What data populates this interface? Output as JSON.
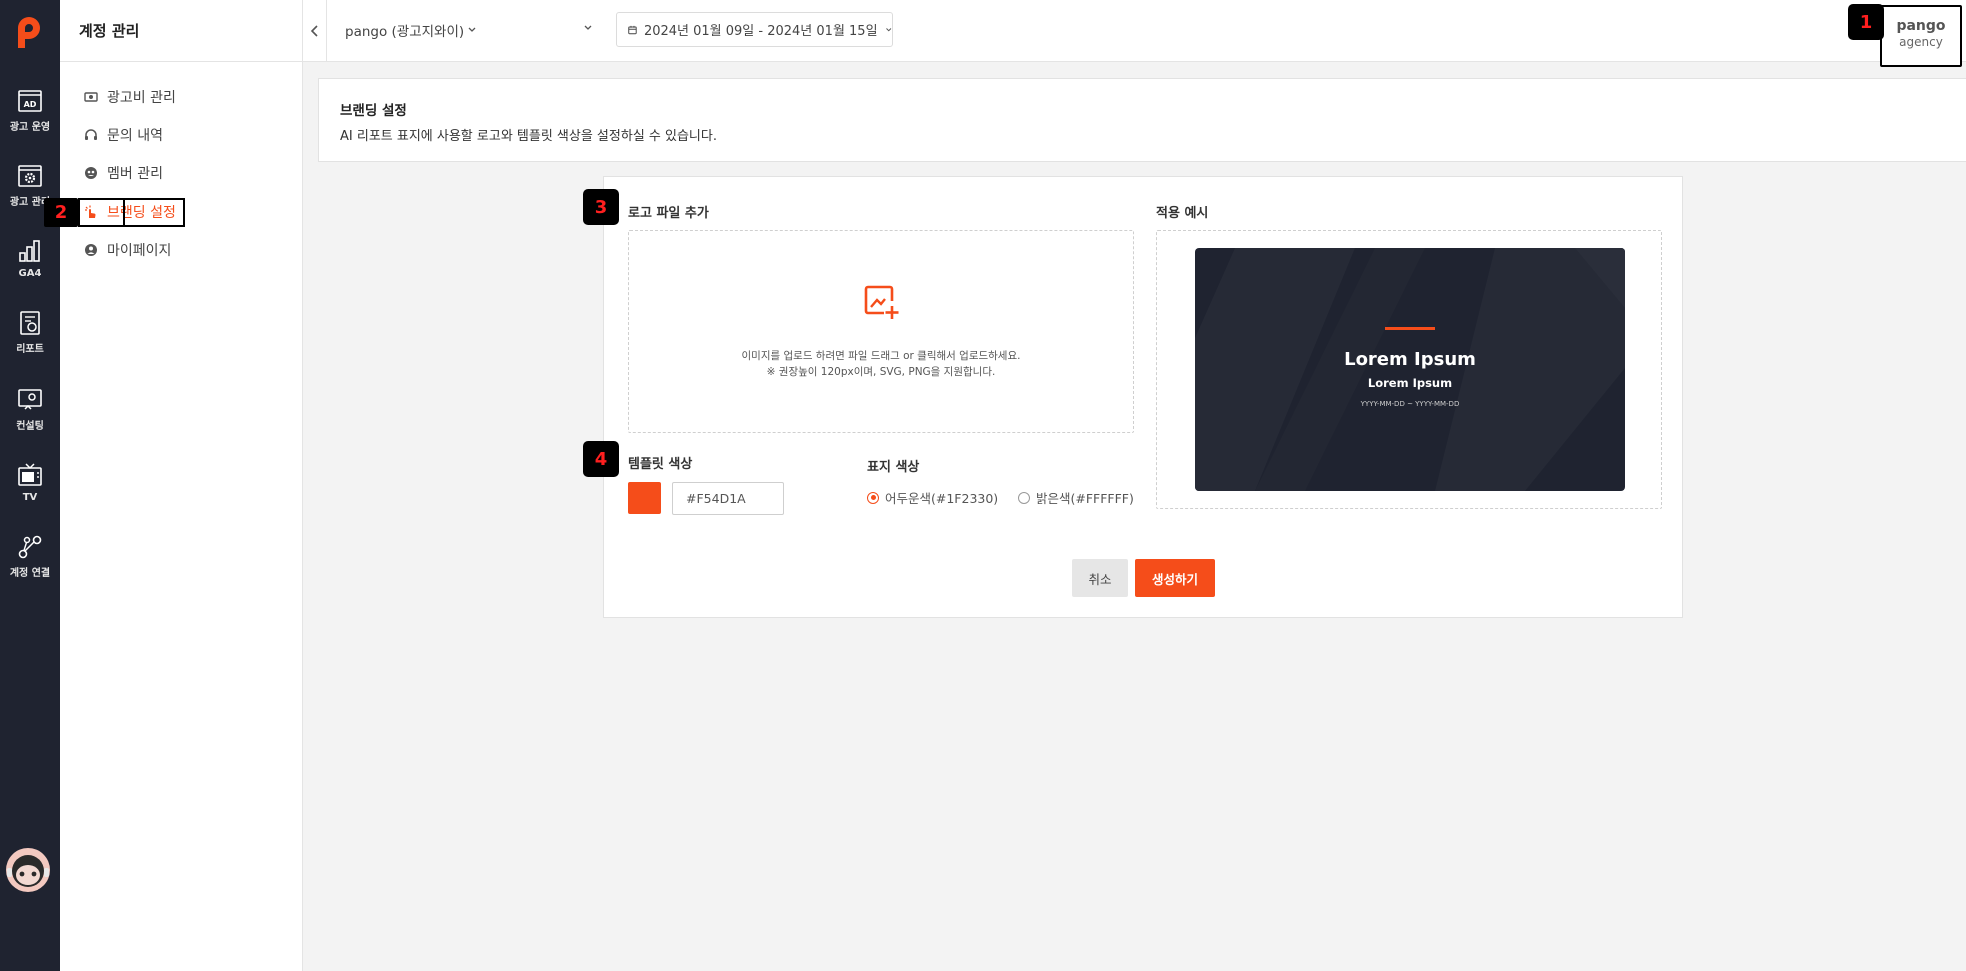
{
  "colors": {
    "brand": "#F54D1A",
    "rail": "#1f2330"
  },
  "rail": [
    {
      "label": "광고 운영",
      "icon": "ad-icon"
    },
    {
      "label": "광고 관리",
      "icon": "gear-icon"
    },
    {
      "label": "GA4",
      "icon": "chart-icon"
    },
    {
      "label": "리포트",
      "icon": "report-icon"
    },
    {
      "label": "컨설팅",
      "icon": "consulting-icon"
    },
    {
      "label": "TV",
      "icon": "tv-icon"
    },
    {
      "label": "계정 연결",
      "icon": "link-icon"
    }
  ],
  "submenu": {
    "title": "계정 관리",
    "items": [
      {
        "label": "광고비 관리",
        "icon": "money-icon"
      },
      {
        "label": "문의 내역",
        "icon": "headset-icon"
      },
      {
        "label": "멤버 관리",
        "icon": "members-icon"
      },
      {
        "label": "브랜딩 설정",
        "icon": "branding-icon",
        "active": true
      },
      {
        "label": "마이페이지",
        "icon": "user-icon"
      }
    ]
  },
  "topbar": {
    "account": "pango (광고지와이)",
    "date_range": "2024년 01월 09일 - 2024년 01월 15일"
  },
  "profile": {
    "name": "pango",
    "org": "agency"
  },
  "page": {
    "title": "브랜딩 설정",
    "description": "AI 리포트 표지에 사용할 로고와 템플릿 색상을 설정하실 수 있습니다."
  },
  "form": {
    "logo_label": "로고 파일 추가",
    "upload_text_1": "이미지를 업로드 하려면 파일 드래그 or 클릭해서 업로드하세요.",
    "upload_text_2": "※ 권장높이 120px이며, SVG, PNG을 지원합니다.",
    "preview_label": "적용 예시",
    "preview": {
      "title": "Lorem Ipsum",
      "subtitle": "Lorem Ipsum",
      "date": "YYYY-MM-DD ~ YYYY-MM-DD"
    },
    "template_color_label": "템플릿 색상",
    "template_color_value": "#F54D1A",
    "cover_color_label": "표지 색상",
    "cover_options": [
      {
        "label": "어두운색(#1F2330)",
        "checked": true
      },
      {
        "label": "밝은색(#FFFFFF)",
        "checked": false
      }
    ],
    "cancel": "취소",
    "create": "생성하기"
  },
  "annotations": [
    "1",
    "2",
    "3",
    "4"
  ]
}
